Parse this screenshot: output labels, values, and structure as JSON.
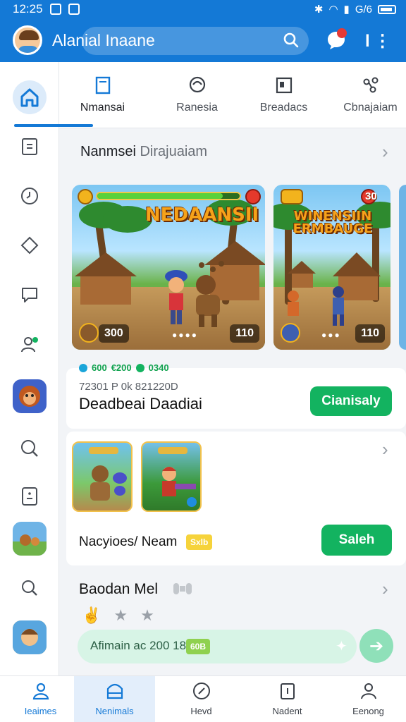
{
  "status_bar": {
    "time": "12:25",
    "right_text": "G/6"
  },
  "app_bar": {
    "title": "Alanial Inaane"
  },
  "tabs": [
    {
      "label": "Nmansai",
      "icon": "book-icon"
    },
    {
      "label": "Ranesia",
      "icon": "refresh-icon"
    },
    {
      "label": "Breadacs",
      "icon": "news-icon"
    },
    {
      "label": "Cbnajaiam",
      "icon": "network-icon"
    }
  ],
  "section1": {
    "title": "Nanmsei",
    "title_muted": "Dirajuaiam"
  },
  "game_cards": [
    {
      "title": "NEDAANSII",
      "score_left": "300",
      "score_right": "110"
    },
    {
      "title": "WINENSIIN ERMBAUGE",
      "score_right": "110",
      "coin_value": "30"
    }
  ],
  "info_card": {
    "chips": [
      "600",
      "€200",
      "0340"
    ],
    "meta": "72301 P 0k 821220D",
    "title": "Deadbeai Daadiai",
    "button": "Cianisaly"
  },
  "thumb_row": {
    "name": "Nacyioes/ Neam",
    "tag": "Sxlb",
    "button": "Saleh"
  },
  "section3": {
    "title": "Baodan Mel",
    "stars": [
      "✌",
      "★",
      "★"
    ],
    "promo_text": "Afimain ac 200 18",
    "promo_tag": "60B",
    "promo_go": "➔"
  },
  "bottom_nav": [
    {
      "label": "Ieaimes"
    },
    {
      "label": "Nenimals"
    },
    {
      "label": "Hevd"
    },
    {
      "label": "Nadent"
    },
    {
      "label": "Eenong"
    }
  ],
  "colors": {
    "primary": "#1479d6",
    "green": "#13b360",
    "promo": "#d7f4e6"
  }
}
